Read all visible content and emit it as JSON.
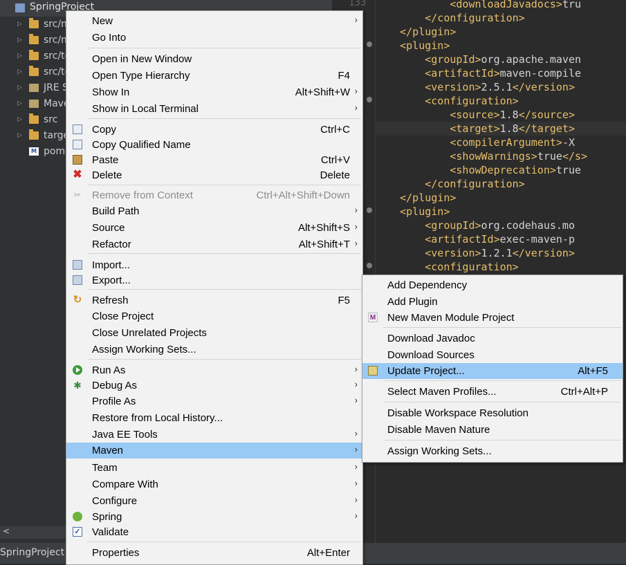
{
  "explorer": {
    "root_label": "SpringProject",
    "items": [
      {
        "label": "src/m",
        "icon": "folder-icon"
      },
      {
        "label": "src/m",
        "icon": "folder-icon"
      },
      {
        "label": "src/te",
        "icon": "folder-icon"
      },
      {
        "label": "src/te",
        "icon": "folder-icon"
      },
      {
        "label": "JRE S",
        "icon": "library-icon"
      },
      {
        "label": "Mave",
        "icon": "library-icon"
      },
      {
        "label": "src",
        "icon": "folder-icon"
      },
      {
        "label": "targe",
        "icon": "folder-icon"
      },
      {
        "label": "pom",
        "icon": "maven-file-icon"
      }
    ],
    "scroll_left": "<"
  },
  "status_bar": {
    "text": "SpringProject"
  },
  "editor": {
    "top_line_number": "133",
    "lines": [
      {
        "indent": "            ",
        "open": "downloadJavadocs",
        "text": "tru",
        "close": ""
      },
      {
        "indent": "        ",
        "open": "",
        "text": "",
        "close": "/configuration"
      },
      {
        "indent": "    ",
        "open": "",
        "text": "",
        "close": "/plugin"
      },
      {
        "indent": "    ",
        "open": "plugin",
        "text": "",
        "close": ""
      },
      {
        "indent": "        ",
        "open": "groupId",
        "text": "org.apache.maven",
        "close": ""
      },
      {
        "indent": "        ",
        "open": "artifactId",
        "text": "maven-compile",
        "close": ""
      },
      {
        "indent": "        ",
        "open": "version",
        "text": "2.5.1",
        "close": "/version"
      },
      {
        "indent": "        ",
        "open": "configuration",
        "text": "",
        "close": ""
      },
      {
        "indent": "            ",
        "open": "source",
        "text": "1.8",
        "close": "/source"
      },
      {
        "indent": "            ",
        "open": "target",
        "text": "1.8",
        "close": "/target"
      },
      {
        "indent": "            ",
        "open": "compilerArgument",
        "text": "-X",
        "close": ""
      },
      {
        "indent": "            ",
        "open": "showWarnings",
        "text": "true",
        "close": "/s"
      },
      {
        "indent": "            ",
        "open": "showDeprecation",
        "text": "true",
        "close": ""
      },
      {
        "indent": "        ",
        "open": "",
        "text": "",
        "close": "/configuration"
      },
      {
        "indent": "    ",
        "open": "",
        "text": "",
        "close": "/plugin"
      },
      {
        "indent": "    ",
        "open": "plugin",
        "text": "",
        "close": ""
      },
      {
        "indent": "        ",
        "open": "groupId",
        "text": "org.codehaus.mo",
        "close": ""
      },
      {
        "indent": "        ",
        "open": "artifactId",
        "text": "exec-maven-p",
        "close": ""
      },
      {
        "indent": "        ",
        "open": "version",
        "text": "1.2.1",
        "close": "/version"
      },
      {
        "indent": "        ",
        "open": "configuration",
        "text": "",
        "close": ""
      }
    ]
  },
  "context_menu": {
    "items": [
      {
        "label": "New",
        "accel": "",
        "submenu": true,
        "icon": ""
      },
      {
        "label": "Go Into",
        "accel": "",
        "submenu": false,
        "icon": ""
      },
      {
        "label": "Open in New Window",
        "accel": "",
        "submenu": false,
        "icon": ""
      },
      {
        "label": "Open Type Hierarchy",
        "accel": "F4",
        "submenu": false,
        "icon": ""
      },
      {
        "label": "Show In",
        "accel": "Alt+Shift+W",
        "submenu": true,
        "icon": ""
      },
      {
        "label": "Show in Local Terminal",
        "accel": "",
        "submenu": true,
        "icon": ""
      },
      {
        "label": "Copy",
        "accel": "Ctrl+C",
        "submenu": false,
        "icon": "copy-icon"
      },
      {
        "label": "Copy Qualified Name",
        "accel": "",
        "submenu": false,
        "icon": "copy-qualified-icon"
      },
      {
        "label": "Paste",
        "accel": "Ctrl+V",
        "submenu": false,
        "icon": "paste-icon"
      },
      {
        "label": "Delete",
        "accel": "Delete",
        "submenu": false,
        "icon": "delete-icon"
      },
      {
        "label": "Remove from Context",
        "accel": "Ctrl+Alt+Shift+Down",
        "submenu": false,
        "icon": "remove-context-icon",
        "disabled": true
      },
      {
        "label": "Build Path",
        "accel": "",
        "submenu": true,
        "icon": ""
      },
      {
        "label": "Source",
        "accel": "Alt+Shift+S",
        "submenu": true,
        "icon": ""
      },
      {
        "label": "Refactor",
        "accel": "Alt+Shift+T",
        "submenu": true,
        "icon": ""
      },
      {
        "label": "Import...",
        "accel": "",
        "submenu": false,
        "icon": "import-icon"
      },
      {
        "label": "Export...",
        "accel": "",
        "submenu": false,
        "icon": "export-icon"
      },
      {
        "label": "Refresh",
        "accel": "F5",
        "submenu": false,
        "icon": "refresh-icon"
      },
      {
        "label": "Close Project",
        "accel": "",
        "submenu": false,
        "icon": ""
      },
      {
        "label": "Close Unrelated Projects",
        "accel": "",
        "submenu": false,
        "icon": ""
      },
      {
        "label": "Assign Working Sets...",
        "accel": "",
        "submenu": false,
        "icon": ""
      },
      {
        "label": "Run As",
        "accel": "",
        "submenu": true,
        "icon": "run-icon"
      },
      {
        "label": "Debug As",
        "accel": "",
        "submenu": true,
        "icon": "debug-icon"
      },
      {
        "label": "Profile As",
        "accel": "",
        "submenu": true,
        "icon": ""
      },
      {
        "label": "Restore from Local History...",
        "accel": "",
        "submenu": false,
        "icon": ""
      },
      {
        "label": "Java EE Tools",
        "accel": "",
        "submenu": true,
        "icon": ""
      },
      {
        "label": "Maven",
        "accel": "",
        "submenu": true,
        "icon": "",
        "selected": true
      },
      {
        "label": "Team",
        "accel": "",
        "submenu": true,
        "icon": ""
      },
      {
        "label": "Compare With",
        "accel": "",
        "submenu": true,
        "icon": ""
      },
      {
        "label": "Configure",
        "accel": "",
        "submenu": true,
        "icon": ""
      },
      {
        "label": "Spring",
        "accel": "",
        "submenu": true,
        "icon": "spring-icon"
      },
      {
        "label": "Validate",
        "accel": "",
        "submenu": false,
        "icon": "validate-check-icon"
      },
      {
        "label": "Properties",
        "accel": "Alt+Enter",
        "submenu": false,
        "icon": ""
      }
    ]
  },
  "maven_menu": {
    "items": [
      {
        "label": "Add Dependency",
        "accel": "",
        "icon": ""
      },
      {
        "label": "Add Plugin",
        "accel": "",
        "icon": ""
      },
      {
        "label": "New Maven Module Project",
        "accel": "",
        "icon": "maven-module-icon"
      },
      {
        "label": "Download Javadoc",
        "accel": "",
        "icon": ""
      },
      {
        "label": "Download Sources",
        "accel": "",
        "icon": ""
      },
      {
        "label": "Update Project...",
        "accel": "Alt+F5",
        "icon": "update-project-icon",
        "selected": true
      },
      {
        "label": "Select Maven Profiles...",
        "accel": "Ctrl+Alt+P",
        "icon": ""
      },
      {
        "label": "Disable Workspace Resolution",
        "accel": "",
        "icon": ""
      },
      {
        "label": "Disable Maven Nature",
        "accel": "",
        "icon": ""
      },
      {
        "label": "Assign Working Sets...",
        "accel": "",
        "icon": ""
      }
    ]
  },
  "colors": {
    "menu_background": "#f2f2f2",
    "menu_selection": "#99c9f5",
    "editor_background": "#2b2b2b",
    "xml_tag": "#e8bf6a"
  }
}
